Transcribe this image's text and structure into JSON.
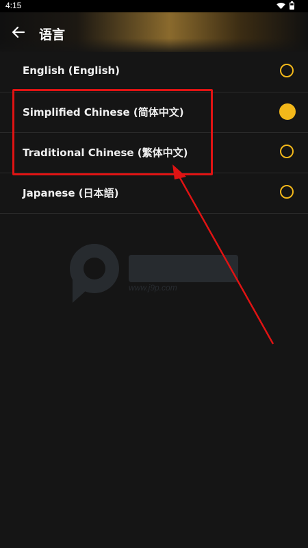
{
  "status_bar": {
    "time": "4:15",
    "icons": [
      "wifi-icon",
      "battery-icon"
    ]
  },
  "header": {
    "back_icon": "arrow-left-icon",
    "title": "语言"
  },
  "languages": [
    {
      "label": "English (English)",
      "selected": false
    },
    {
      "label": "Simplified Chinese (简体中文)",
      "selected": true
    },
    {
      "label": "Traditional Chinese (繁体中文)",
      "selected": false
    },
    {
      "label": "Japanese (日本語)",
      "selected": false
    }
  ],
  "colors": {
    "accent": "#f3b81a",
    "background": "#151515",
    "annotation": "#e01313"
  },
  "watermark": {
    "text": "www.j9p.com"
  }
}
